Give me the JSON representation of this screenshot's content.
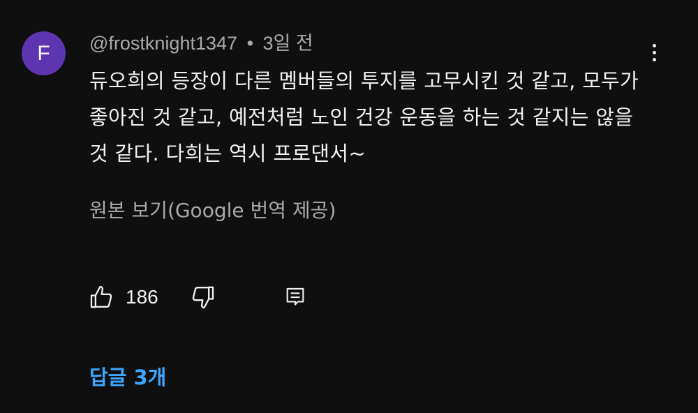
{
  "comment": {
    "avatar_letter": "F",
    "avatar_color": "#5e35b1",
    "author": "@frostknight1347",
    "separator": "•",
    "time": "3일 전",
    "text": "듀오희의 등장이 다른 멤버들의 투지를 고무시킨 것 같고, 모두가 좋아진 것 같고, 예전처럼 노인 건강 운동을 하는 것 같지는 않을 것 같다. 다희는 역시 프로댄서~",
    "translate_label": "원본 보기(Google 번역 제공)",
    "like_count": "186",
    "replies_label": "답글 3개",
    "accent_color": "#3ea6ff"
  },
  "icons": {
    "more": "more-vertical-icon",
    "like": "thumb-up-icon",
    "dislike": "thumb-down-icon",
    "reply": "reply-comment-icon"
  }
}
